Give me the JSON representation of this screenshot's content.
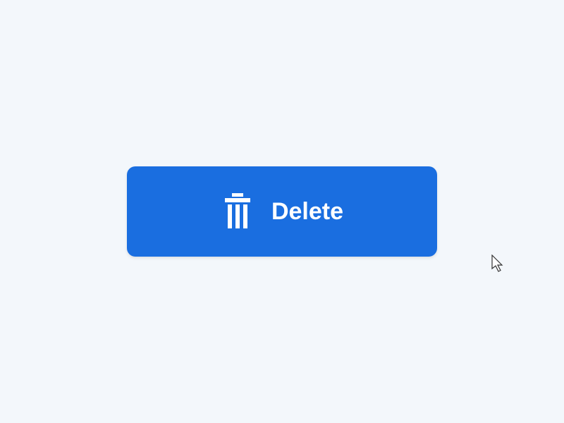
{
  "button": {
    "label": "Delete"
  }
}
